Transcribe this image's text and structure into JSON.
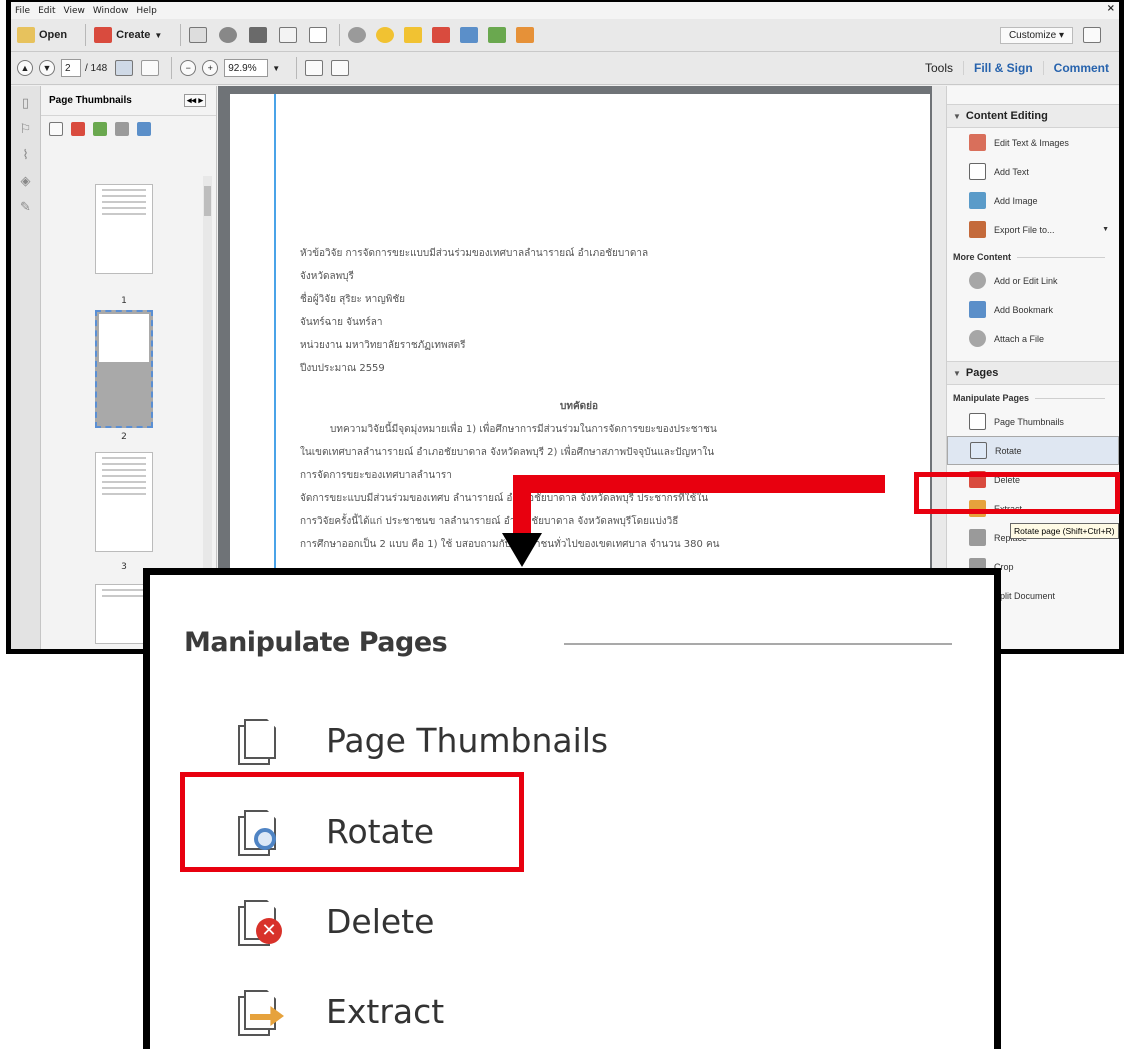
{
  "menubar": {
    "items": [
      "File",
      "Edit",
      "View",
      "Window",
      "Help"
    ],
    "close": "×"
  },
  "toolbar": {
    "open_label": "Open",
    "create_label": "Create",
    "customize_label": "Customize",
    "page_current": "2",
    "page_total": "/ 148",
    "zoom_value": "92.9%"
  },
  "tabs": {
    "tools": "Tools",
    "fill_sign": "Fill & Sign",
    "comment": "Comment"
  },
  "thumbnails": {
    "title": "Page Thumbnails",
    "page_numbers": [
      "1",
      "2",
      "3"
    ]
  },
  "document": {
    "lines": [
      "หัวข้อวิจัย        การจัดการขยะแบบมีส่วนร่วมของเทศบาลลำนารายณ์ อำเภอชัยบาดาล",
      "                    จังหวัดลพบุรี",
      "ชื่อผู้วิจัย         สุริยะ  หาญพิชัย",
      "                    จันทร์ฉาย  จันทร์ลา",
      "หน่วยงาน          มหาวิทยาลัยราชภัฏเทพสตรี",
      "ปีงบประมาณ       2559",
      "บทคัดย่อ",
      "บทความวิจัยนี้มีจุดมุ่งหมายเพื่อ 1) เพื่อศึกษาการมีส่วนร่วมในการจัดการขยะของประชาชน",
      "ในเขตเทศบาลลำนารายณ์ อำเภอชัยบาดาล จังหวัดลพบุรี 2)  เพื่อศึกษาสภาพปัจจุบันและปัญหาใน",
      "การจัดการขยะของเทศบาลลำนารา",
      "จัดการขยะแบบมีส่วนร่วมของเทศบ      ลำนารายณ์ อำเภอชัยบาดาล จังหวัดลพบุรี ประชากรที่ใช้ใน",
      "การวิจัยครั้งนี้ได้แก่ ประชาชนข      าลลำนารายณ์ อำเภอชัยบาดาล จังหวัดลพบุรีโดยแบ่งวิธี",
      "การศึกษาออกเป็น 2 แบบ คือ 1) ใช้      บสอบถามกับประชาชนทั่วไปของเขตเทศบาล จำนวน 380 คน"
    ]
  },
  "tools_pane": {
    "content_editing": "Content Editing",
    "content_items": [
      "Edit Text & Images",
      "Add Text",
      "Add Image",
      "Export File to..."
    ],
    "more_content": "More Content",
    "more_items": [
      "Add or Edit Link",
      "Add Bookmark",
      "Attach a File"
    ],
    "pages": "Pages",
    "manipulate_pages": "Manipulate Pages",
    "page_items": [
      "Page Thumbnails",
      "Rotate",
      "Delete",
      "Extract",
      "Replace",
      "Crop",
      "Split Document"
    ],
    "tooltip": "Rotate page (Shift+Ctrl+R)"
  },
  "zoom_callout": {
    "title": "Manipulate Pages",
    "items": [
      "Page Thumbnails",
      "Rotate",
      "Delete",
      "Extract"
    ]
  },
  "colors": {
    "annotation_red": "#e8000f",
    "accent_blue": "#2763ad"
  }
}
